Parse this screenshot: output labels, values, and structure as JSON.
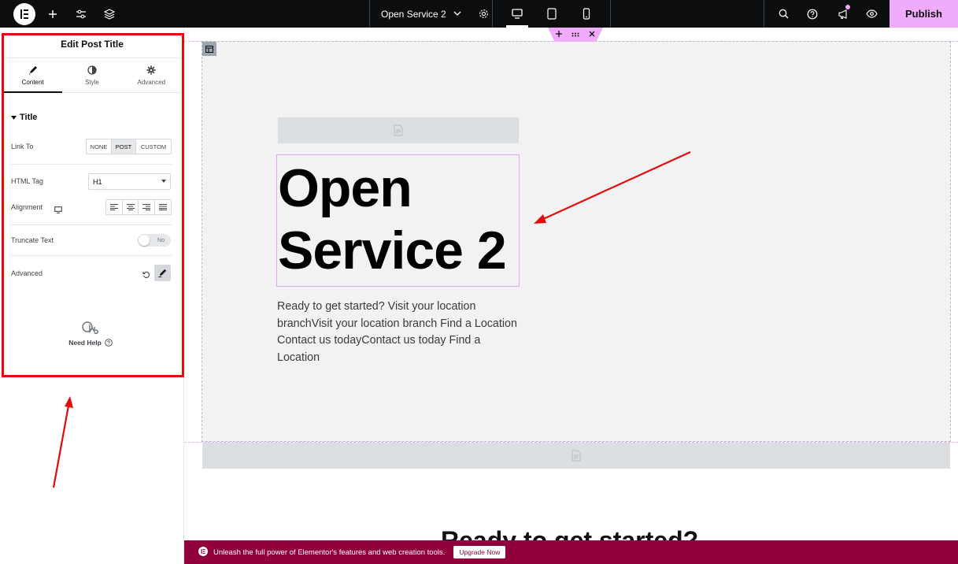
{
  "topbar": {
    "document_title": "Open Service 2",
    "publish_label": "Publish",
    "icons": [
      "elementor-logo",
      "add-element-icon",
      "site-settings-icon",
      "structure-icon",
      "chevron-down-icon",
      "page-settings-icon",
      "desktop-icon",
      "tablet-icon",
      "mobile-icon",
      "search-icon",
      "help-icon",
      "whats-new-icon",
      "preview-icon"
    ],
    "accent_color": "#f0abfc"
  },
  "panel": {
    "header_title": "Edit Post Title",
    "tabs": [
      {
        "label": "Content",
        "icon": "pencil-icon"
      },
      {
        "label": "Style",
        "icon": "half-circle-icon"
      },
      {
        "label": "Advanced",
        "icon": "gear-icon"
      }
    ],
    "section_title": "Title",
    "link_to": {
      "label": "Link To",
      "options": [
        "NONE",
        "POST",
        "CUSTOM"
      ],
      "selected": "POST"
    },
    "html_tag": {
      "label": "HTML Tag",
      "value": "H1"
    },
    "alignment": {
      "label": "Alignment",
      "device_icon": "desktop-icon",
      "options": [
        "left",
        "center",
        "right",
        "justify"
      ]
    },
    "truncate": {
      "label": "Truncate Text",
      "state": "No"
    },
    "advanced": {
      "label": "Advanced"
    },
    "need_help": "Need Help",
    "highlight_color": "#e30b0b"
  },
  "canvas": {
    "post_title": "Open Service 2",
    "body_text": "Ready to get started? Visit your location branchVisit your location branch Find a Location Contact us todayContact us today Find a Location",
    "bottom_heading": "Ready to get started?",
    "background": "#f2f2f2"
  },
  "banner": {
    "text": "Unleash the full power of Elementor's features and web creation tools.",
    "button": "Upgrade Now",
    "color": "#92003b"
  }
}
